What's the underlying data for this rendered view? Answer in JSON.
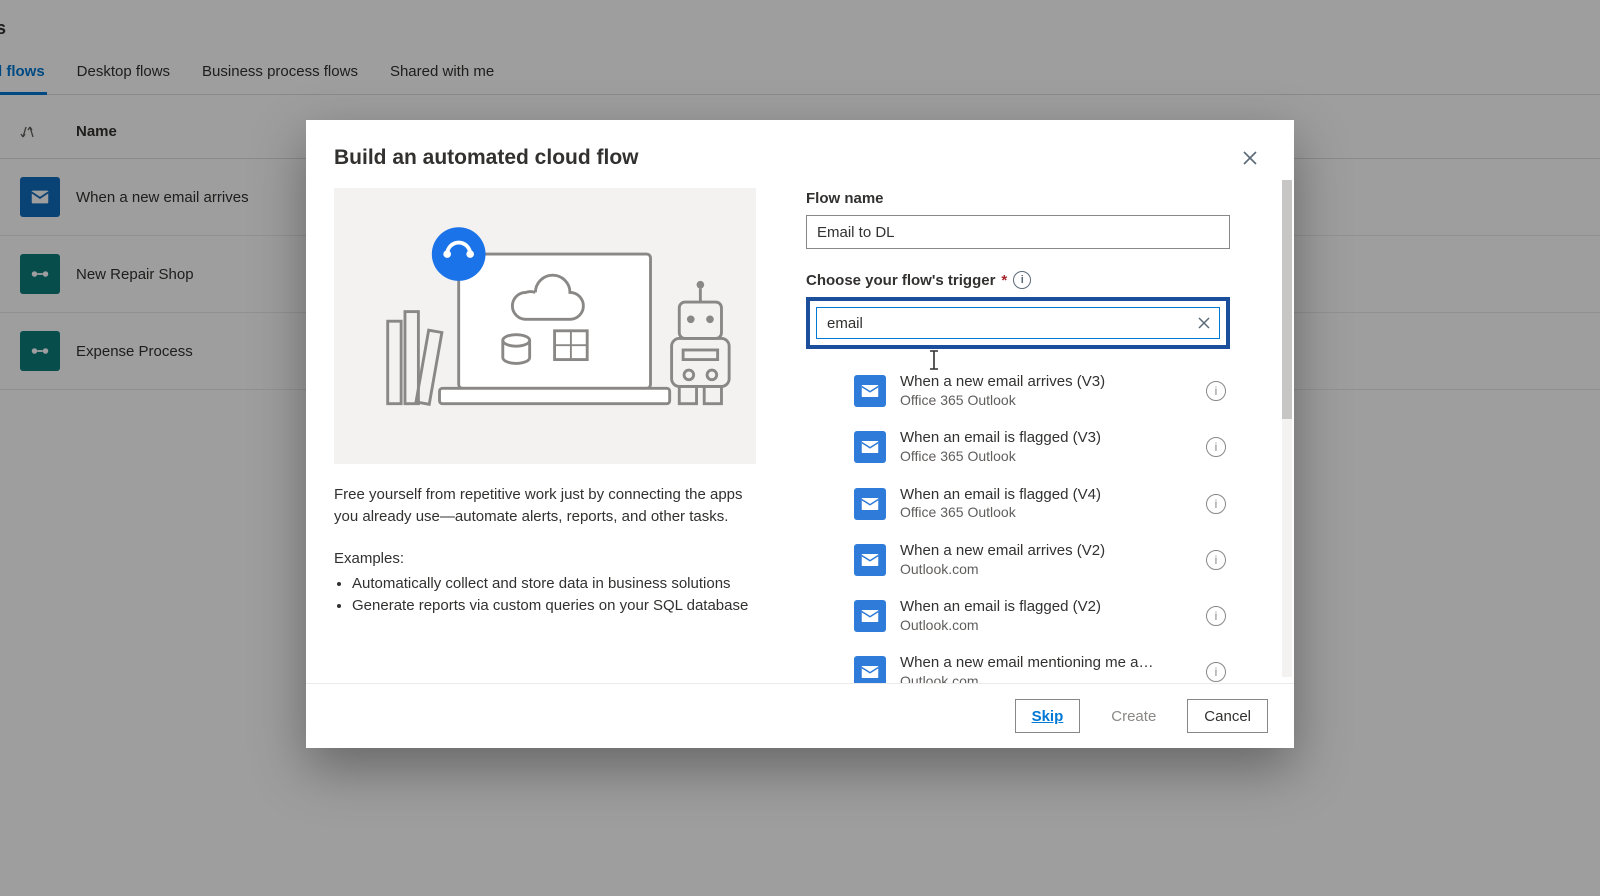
{
  "page": {
    "heading_fragment": "ws",
    "tabs": [
      {
        "label": "l flows",
        "active": true
      },
      {
        "label": "Desktop flows",
        "active": false
      },
      {
        "label": "Business process flows",
        "active": false
      },
      {
        "label": "Shared with me",
        "active": false
      }
    ],
    "list_header": {
      "name": "Name"
    },
    "flows": [
      {
        "name": "When a new email arrives",
        "icon": "outlook"
      },
      {
        "name": "New Repair Shop",
        "icon": "teal"
      },
      {
        "name": "Expense Process",
        "icon": "teal"
      }
    ]
  },
  "dialog": {
    "title": "Build an automated cloud flow",
    "left": {
      "paragraph": "Free yourself from repetitive work just by connecting the apps you already use—automate alerts, reports, and other tasks.",
      "examples_label": "Examples:",
      "examples": [
        "Automatically collect and store data in business solutions",
        "Generate reports via custom queries on your SQL database"
      ]
    },
    "flow_name": {
      "label": "Flow name",
      "value": "Email to DL"
    },
    "trigger": {
      "label": "Choose your flow's trigger",
      "required_mark": "*",
      "search_value": "email",
      "results": [
        {
          "title": "When a new email arrives (V3)",
          "sub": "Office 365 Outlook"
        },
        {
          "title": "When an email is flagged (V3)",
          "sub": "Office 365 Outlook"
        },
        {
          "title": "When an email is flagged (V4)",
          "sub": "Office 365 Outlook"
        },
        {
          "title": "When a new email arrives (V2)",
          "sub": "Outlook.com"
        },
        {
          "title": "When an email is flagged (V2)",
          "sub": "Outlook.com"
        },
        {
          "title": "When a new email mentioning me a…",
          "sub": "Outlook.com"
        }
      ]
    },
    "footer": {
      "skip": "Skip",
      "create": "Create",
      "cancel": "Cancel"
    }
  }
}
